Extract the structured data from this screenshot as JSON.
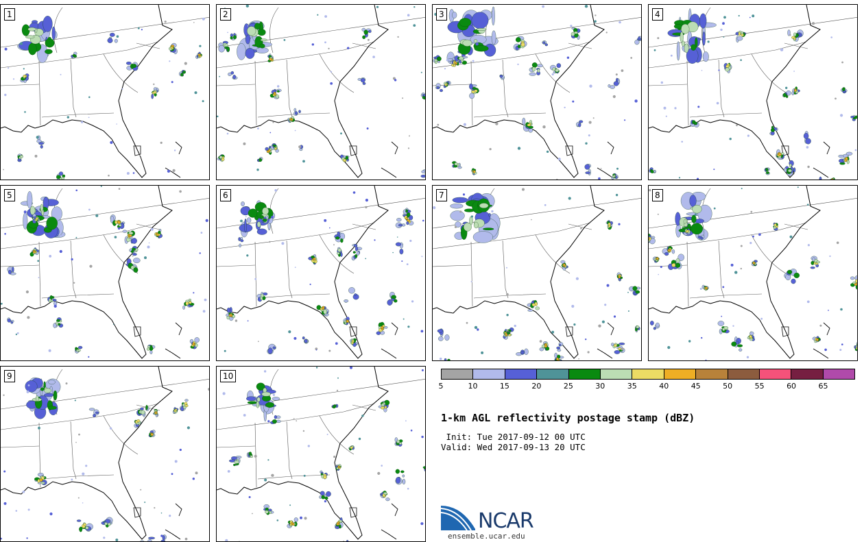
{
  "panels": [
    {
      "label": "1"
    },
    {
      "label": "2"
    },
    {
      "label": "3"
    },
    {
      "label": "4"
    },
    {
      "label": "5"
    },
    {
      "label": "6"
    },
    {
      "label": "7"
    },
    {
      "label": "8"
    },
    {
      "label": "9"
    },
    {
      "label": "10"
    }
  ],
  "colorbar": {
    "colors": [
      "#a4a4a4",
      "#b1baeb",
      "#5660d6",
      "#4f9398",
      "#0a8a10",
      "#bcddb4",
      "#ecdc64",
      "#eeae24",
      "#b8823a",
      "#8c5c3e",
      "#f4527a",
      "#761f41",
      "#b04aaa"
    ],
    "ticks": [
      "5",
      "10",
      "15",
      "20",
      "25",
      "30",
      "35",
      "40",
      "45",
      "50",
      "55",
      "60",
      "65"
    ]
  },
  "title": "1-km AGL reflectivity postage stamp (dBZ)",
  "init": " Init: Tue 2017-09-12 00 UTC",
  "valid": "Valid: Wed 2017-09-13 20 UTC",
  "logo": {
    "name": "NCAR",
    "url": "ensemble.ucar.edu"
  }
}
